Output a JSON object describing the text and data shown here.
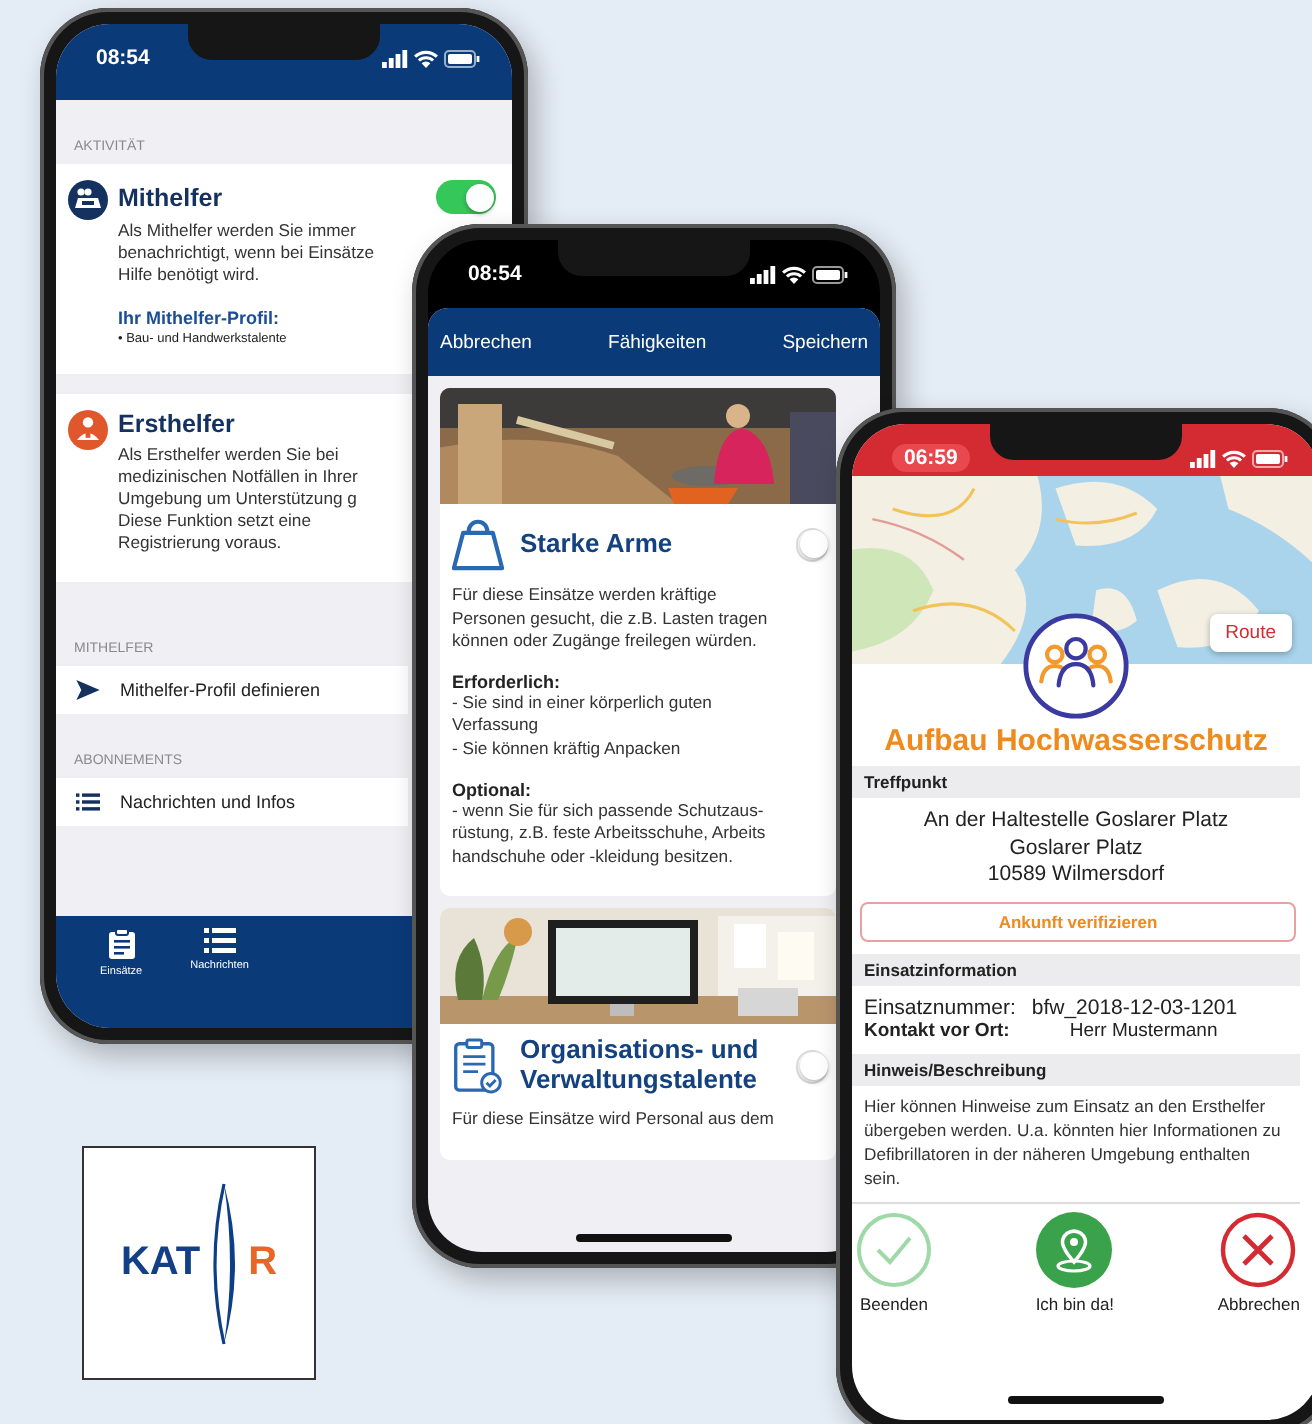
{
  "settings_phone": {
    "time": "08:54",
    "section_label": "AKTIVITÄT",
    "activities": [
      {
        "kind": "helper",
        "title": "Mithelfer",
        "on": true,
        "description": "Als Mithelfer werden Sie immer\nbenachrichtigt, wenn bei Einsätze\nHilfe benötigt wird.",
        "profile_title": "Ihr Mithelfer-Profil:",
        "profile_items": [
          "• Bau- und Handwerkstalente"
        ]
      },
      {
        "kind": "first_aid",
        "title": "Ersthelfer",
        "description": "Als Ersthelfer werden Sie bei\nmedizinischen Notfällen in Ihrer\nUmgebung um Unterstützung g\nDiese Funktion setzt eine\nRegistrierung voraus."
      }
    ],
    "menu_groups": [
      {
        "label": "MITHELFER",
        "items": [
          {
            "kind": "send",
            "label": "Mithelfer-Profil definieren"
          }
        ]
      },
      {
        "label": "ABONNEMENTS",
        "items": [
          {
            "kind": "list",
            "label": "Nachrichten und Infos"
          }
        ]
      }
    ],
    "tabs": [
      {
        "kind": "clipboard",
        "label": "Einsätze",
        "selected": false
      },
      {
        "kind": "list",
        "label": "Nachrichten",
        "selected": false
      }
    ]
  },
  "skills_phone": {
    "time": "08:54",
    "cancel": "Abbrechen",
    "title": "Fähigkeiten",
    "save": "Speichern",
    "cards": [
      {
        "kind": "weight",
        "title": "Starke Arme",
        "selected": false,
        "intro": "Für diese Einsätze werden kräftige\nPersonen gesucht, die z.B. Lasten tragen\nkönnen oder Zugänge freilegen würden.",
        "sections": [
          {
            "heading": "Erforderlich:",
            "text": "-  Sie sind in einer körperlich guten\nVerfassung\n-  Sie können kräftig Anpacken"
          },
          {
            "heading": "Optional:",
            "text": "-  wenn Sie für sich passende Schutzaus-\nrüstung, z.B. feste Arbeitsschuhe, Arbeits\nhandschuhe oder -kleidung besitzen."
          }
        ]
      },
      {
        "kind": "clipboard",
        "title": "Organisations- und\nVerwaltungstalente",
        "selected": false,
        "intro": "Für diese Einsätze wird Personal aus dem"
      }
    ]
  },
  "mission_phone": {
    "time": "06:59",
    "route": "Route",
    "title": "Aufbau Hochwasserschutz",
    "meeting_label": "Treffpunkt",
    "address": "An der Haltestelle Goslarer Platz\nGoslarer Platz\n10589 Wilmersdorf",
    "verify_button": "Ankunft verifizieren",
    "info_label": "Einsatzinformation",
    "info_rows": [
      {
        "label": "Einsatznummer:",
        "value": "bfw_2018-12-03-1201"
      },
      {
        "label": "Kontakt vor Ort:",
        "value": "Herr Mustermann"
      }
    ],
    "note_label": "Hinweis/Beschreibung",
    "note": "Hier können Hinweise zum Einsatz an den Ersthelfer übergeben werden. U.a. könnten hier Informationen zu Defibrillatoren in der näheren Umgebung enthalten sein.",
    "actions": [
      {
        "kind": "finish",
        "label": "Beenden"
      },
      {
        "kind": "arrived",
        "label": "Ich bin da!"
      },
      {
        "kind": "cancel",
        "label": "Abbrechen"
      }
    ]
  },
  "logo": {
    "left": "KAT",
    "right": "R"
  }
}
